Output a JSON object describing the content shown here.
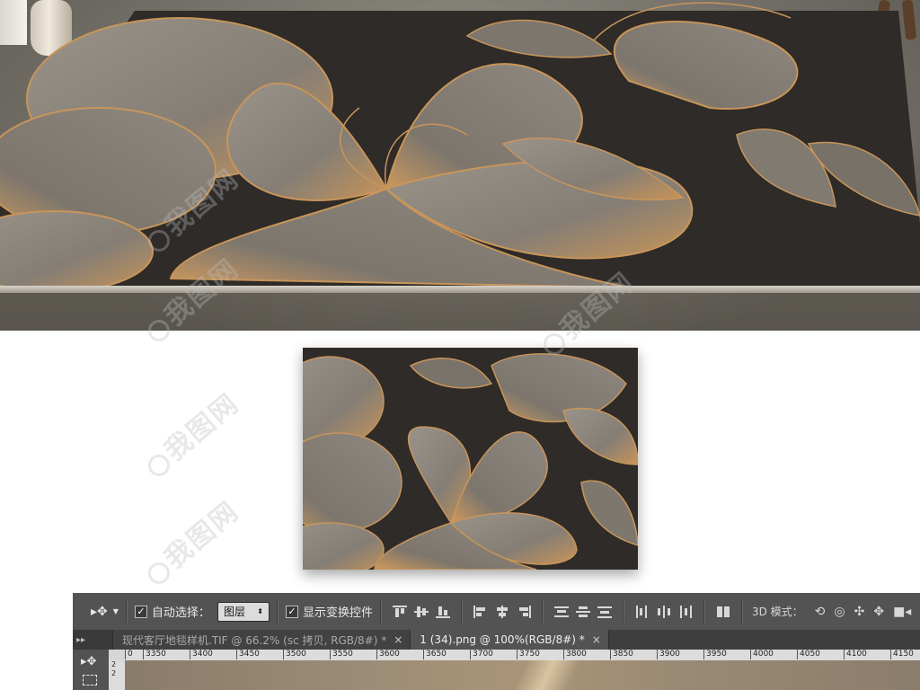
{
  "colors": {
    "carpet_dark": "#2e2b28",
    "petal_gray": "#8a847b",
    "gold": "#c8955a",
    "ps_panel": "#535353"
  },
  "watermark_text": "我图网",
  "photoshop": {
    "move_tool_icon": "move-tool-icon",
    "auto_select_label": "自动选择：",
    "auto_select_value": "图层",
    "show_transform_label": "显示变换控件",
    "mode_3d_label": "3D 模式：",
    "tabs": [
      {
        "label": "现代客厅地毯样机.TIF @ 66.2% (sc 拷贝, RGB/8#) *",
        "active": false
      },
      {
        "label": "1 (34).png @ 100%(RGB/8#) *",
        "active": true
      }
    ],
    "ruler_ticks": [
      "0",
      "3350",
      "3400",
      "3450",
      "3500",
      "3550",
      "3600",
      "3650",
      "3700",
      "3750",
      "3800",
      "3850",
      "3900",
      "3950",
      "4000",
      "4050",
      "4100",
      "4150"
    ],
    "vruler_ticks": [
      "2",
      "2"
    ]
  }
}
